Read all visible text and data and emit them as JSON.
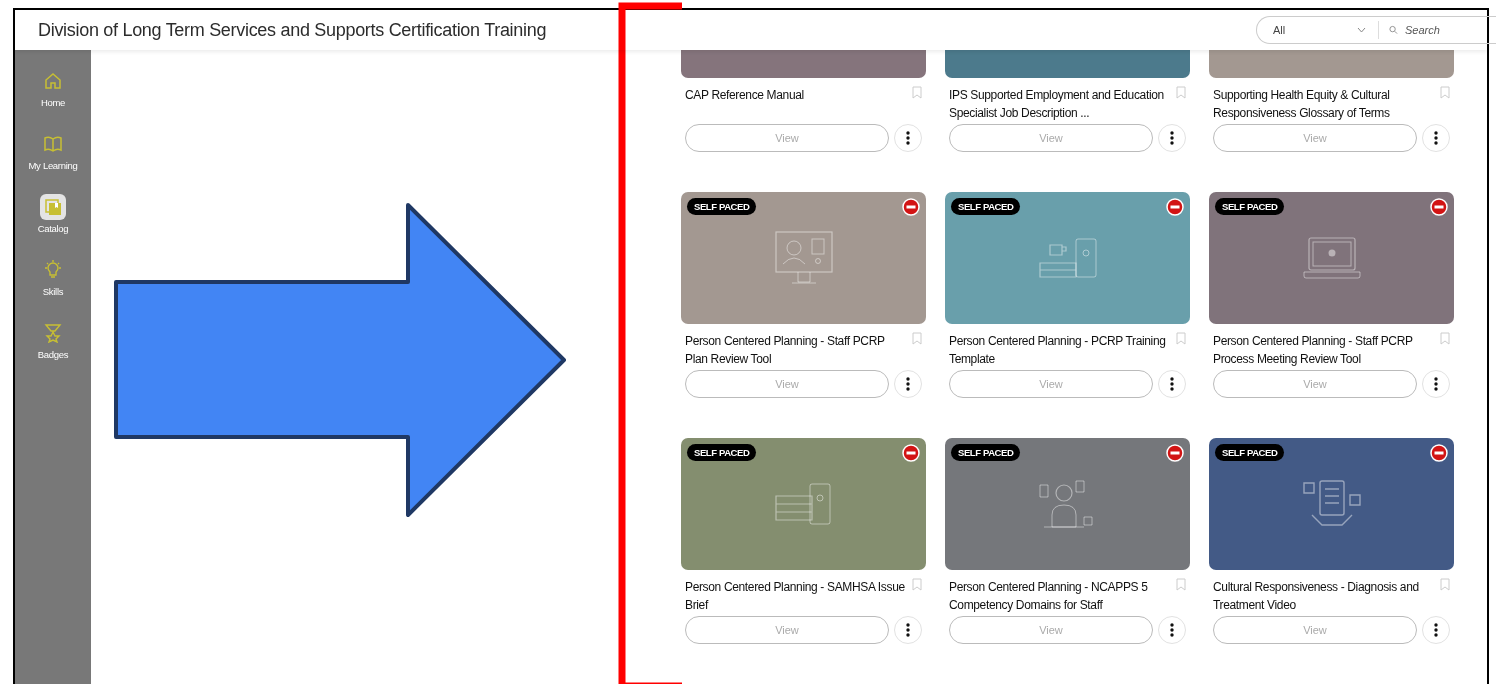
{
  "header": {
    "title": "Division of Long Term Services and Supports Certification Training",
    "filter": {
      "value": "All"
    },
    "search": {
      "placeholder": "Search"
    }
  },
  "sidebar": {
    "items": [
      {
        "label": "Home",
        "selected": false
      },
      {
        "label": "My Learning",
        "selected": false
      },
      {
        "label": "Catalog",
        "selected": true
      },
      {
        "label": "Skills",
        "selected": false
      },
      {
        "label": "Badges",
        "selected": false
      }
    ]
  },
  "catalog": {
    "cards": [
      {
        "title": "CAP Reference Manual",
        "color": "#85747c",
        "button": "View"
      },
      {
        "title": "IPS Supported Employment and Education Specialist Job Description ...",
        "color": "#4c7a8c",
        "button": "View"
      },
      {
        "title": "Supporting Health Equity & Cultural Responsiveness Glossary of Terms",
        "color": "#a39891",
        "button": "View"
      },
      {
        "title": "Person Centered Planning - Staff PCRP Plan Review Tool",
        "color": "#a39891",
        "badge": "SELF PACED",
        "button": "View"
      },
      {
        "title": "Person Centered Planning - PCRP Training Template",
        "color": "#699fab",
        "badge": "SELF PACED",
        "button": "View"
      },
      {
        "title": "Person Centered Planning - Staff PCRP Process Meeting Review Tool",
        "color": "#80737b",
        "badge": "SELF PACED",
        "button": "View"
      },
      {
        "title": "Person Centered Planning - SAMHSA Issue Brief",
        "color": "#848e6f",
        "badge": "SELF PACED",
        "button": "View"
      },
      {
        "title": "Person Centered Planning - NCAPPS 5 Competency Domains for Staff",
        "color": "#75777b",
        "badge": "SELF PACED",
        "button": "View"
      },
      {
        "title": "Cultural Responsiveness - Diagnosis and Treatment Video",
        "color": "#435a86",
        "badge": "SELF PACED",
        "button": "View"
      }
    ]
  }
}
